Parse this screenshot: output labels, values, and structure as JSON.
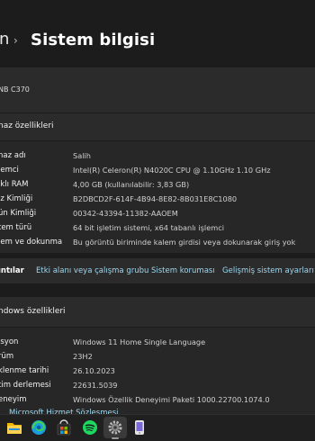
{
  "breadcrumb": {
    "prev_fragment": "n",
    "separator": "›",
    "title": "Sistem bilgisi"
  },
  "device": {
    "name_fragment": "NB C370"
  },
  "device_specs": {
    "header": "naz özellikleri",
    "rows": [
      {
        "label": "naz adı",
        "value": "Salih"
      },
      {
        "label": "lemci",
        "value": "Intel(R) Celeron(R) N4020C CPU @ 1.10GHz   1.10 GHz"
      },
      {
        "label": "ıklı RAM",
        "value": "4,00 GB (kullanılabilir: 3,83 GB)"
      },
      {
        "label": "ız Kimliği",
        "value": "B2DBCD2F-614F-4B94-8E82-8B031E8C1080"
      },
      {
        "label": "ün Kimliği",
        "value": "00342-43394-11382-AAOEM"
      },
      {
        "label": "tem türü",
        "value": "64 bit işletim sistemi, x64 tabanlı işlemci"
      },
      {
        "label": "lem ve dokunma",
        "value": "Bu görüntü biriminde kalem girdisi veya dokunarak giriş yok"
      }
    ]
  },
  "related_links": {
    "label": "ıntılar",
    "links": [
      "Etki alanı veya çalışma grubu",
      "Sistem koruması",
      "Gelişmiş sistem ayarları"
    ]
  },
  "windows_specs": {
    "header": "ndows özellikleri",
    "rows": [
      {
        "label": "isyon",
        "value": "Windows 11 Home Single Language"
      },
      {
        "label": "rüm",
        "value": "23H2"
      },
      {
        "label": "klenme tarihi",
        "value": "26.10.2023"
      },
      {
        "label": "tim derlemesi",
        "value": "22631.5039"
      },
      {
        "label": "eneyim",
        "value": "Windows Özellik Deneyimi Paketi 1000.22700.1074.0"
      }
    ],
    "cut_link": "Microsoft Hizmet Sözleşmesi"
  },
  "taskbar": {
    "icons": [
      "file-explorer-icon",
      "edge-icon",
      "store-icon",
      "spotify-icon",
      "settings-icon",
      "phone-link-icon"
    ],
    "colors": {
      "folder": "#f2b600",
      "edge": "#1b9de2",
      "spotify": "#1ed760"
    }
  }
}
